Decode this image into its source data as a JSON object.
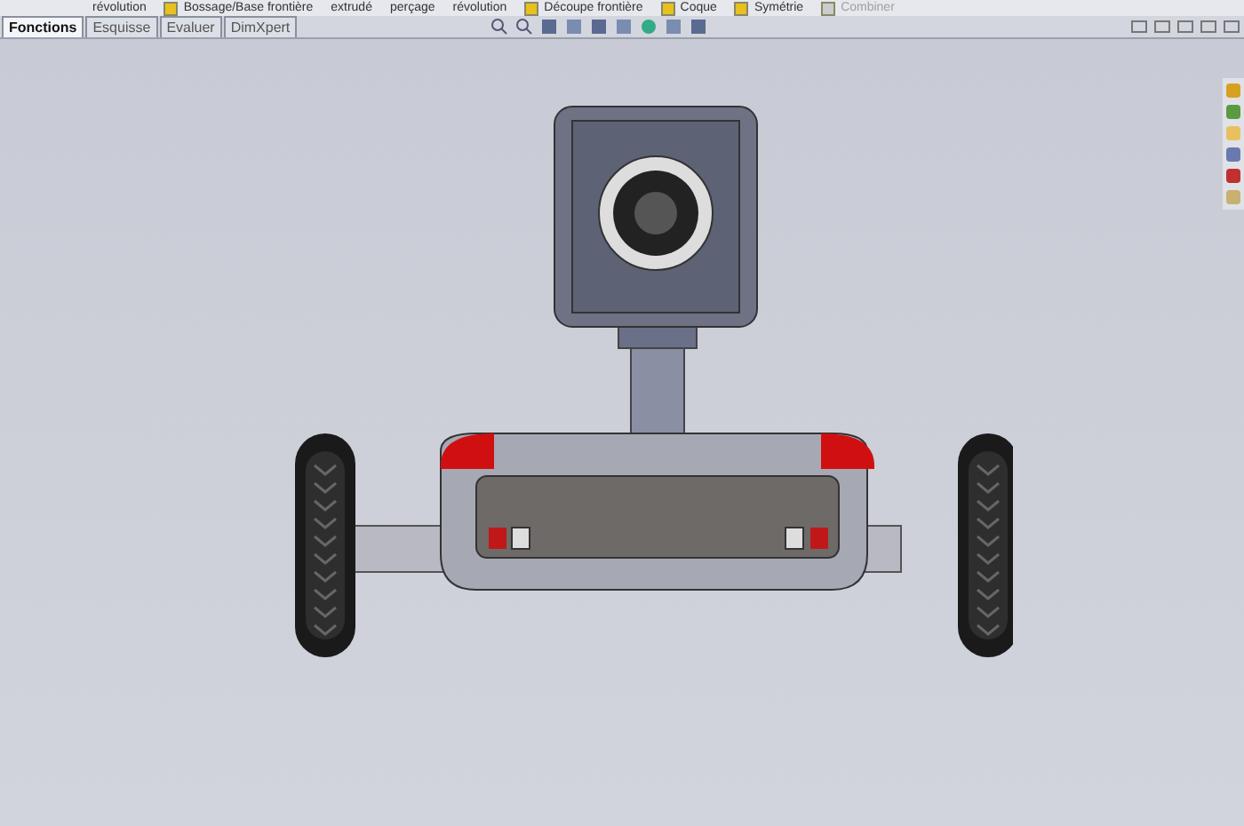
{
  "ribbon": [
    {
      "label": "révolution",
      "kind": "text",
      "disabled": false
    },
    {
      "label": "Bossage/Base frontière",
      "kind": "icon",
      "disabled": false
    },
    {
      "label": "extrudé",
      "kind": "text",
      "disabled": false
    },
    {
      "label": "perçage",
      "kind": "text",
      "disabled": false
    },
    {
      "label": "révolution",
      "kind": "text",
      "disabled": false
    },
    {
      "label": "Découpe frontière",
      "kind": "icon",
      "disabled": false
    },
    {
      "label": "Coque",
      "kind": "icon",
      "disabled": false
    },
    {
      "label": "Symétrie",
      "kind": "icon",
      "disabled": false
    },
    {
      "label": "Combiner",
      "kind": "icon",
      "disabled": true
    }
  ],
  "tabs": [
    {
      "label": "Fonctions",
      "selected": true
    },
    {
      "label": "Esquisse",
      "selected": false
    },
    {
      "label": "Evaluer",
      "selected": false
    },
    {
      "label": "DimXpert",
      "selected": false
    }
  ]
}
